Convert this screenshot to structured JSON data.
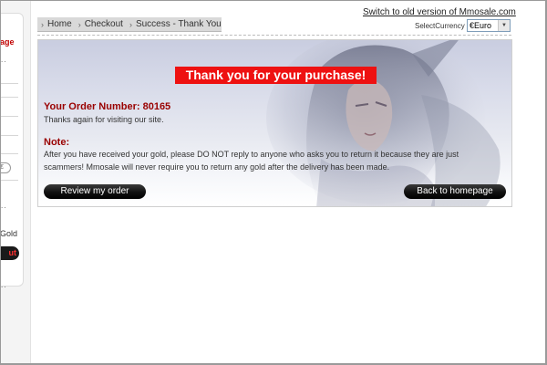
{
  "sidebar": {
    "top_fragment": "age",
    "gold_fragment": "Gold",
    "button_fragment": "ut"
  },
  "breadcrumb": {
    "items": [
      {
        "label": "Home"
      },
      {
        "label": "Checkout"
      },
      {
        "label": "Success - Thank You"
      }
    ]
  },
  "header": {
    "switch_link": "Switch to old version of Mmosale.com",
    "currency_label": "SelectCurrency",
    "currency_value": "€Euro"
  },
  "content": {
    "banner": "Thank you for your purchase!",
    "order_number": "Your Order Number: 80165",
    "thanks_text": "Thanks again for visiting our site.",
    "note_heading": "Note:",
    "note_text": "After you have received your gold, please DO NOT reply to anyone who asks you to return it because they are just scammers! Mmosale will never require you to return any gold after the delivery has been made.",
    "review_button": "Review my order",
    "home_button": "Back to homepage"
  },
  "colors": {
    "banner_bg": "#ee1111",
    "heading_red": "#990000",
    "button_black": "#111111",
    "panel_gradient_top": "#c9cde0"
  }
}
